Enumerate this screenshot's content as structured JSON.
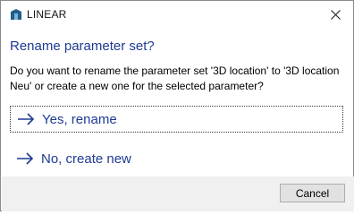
{
  "window": {
    "app_title": "LINEAR",
    "app_icon": "linear-logo-icon",
    "close_icon": "close-icon",
    "accent_color": "#1f3a93"
  },
  "dialog": {
    "heading": "Rename parameter set?",
    "message": "Do you want to rename the parameter set '3D location' to '3D location Neu' or create a new one for the selected parameter?"
  },
  "commands": [
    {
      "label": "Yes, rename",
      "icon": "arrow-right-icon",
      "focused": true
    },
    {
      "label": "No, create new",
      "icon": "arrow-right-icon",
      "focused": false
    }
  ],
  "footer": {
    "cancel_label": "Cancel"
  }
}
